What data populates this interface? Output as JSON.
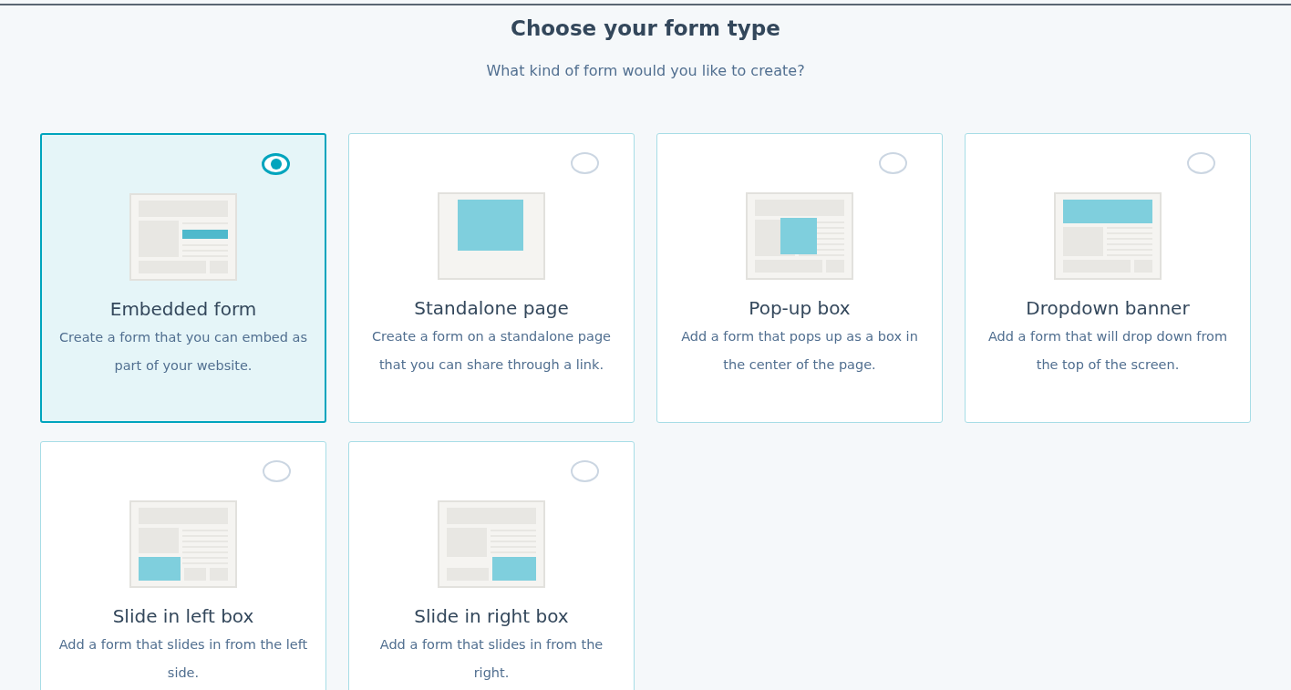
{
  "header": {
    "title": "Choose your form type",
    "subtitle": "What kind of form would you like to create?"
  },
  "cards": [
    {
      "kind": "embedded",
      "title": "Embedded form",
      "description": "Create a form that you can embed as part of your website.",
      "selected": true
    },
    {
      "kind": "standalone",
      "title": "Standalone page",
      "description": "Create a form on a standalone page that you can share through a link.",
      "selected": false
    },
    {
      "kind": "popup",
      "title": "Pop-up box",
      "description": "Add a form that pops up as a box in the center of the page.",
      "selected": false
    },
    {
      "kind": "dropdown",
      "title": "Dropdown banner",
      "description": "Add a form that will drop down from the top of the screen.",
      "selected": false
    },
    {
      "kind": "slide_left",
      "title": "Slide in left box",
      "description": "Add a form that slides in from the left side.",
      "selected": false
    },
    {
      "kind": "slide_right",
      "title": "Slide in right box",
      "description": "Add a form that slides in from the right.",
      "selected": false
    }
  ]
}
